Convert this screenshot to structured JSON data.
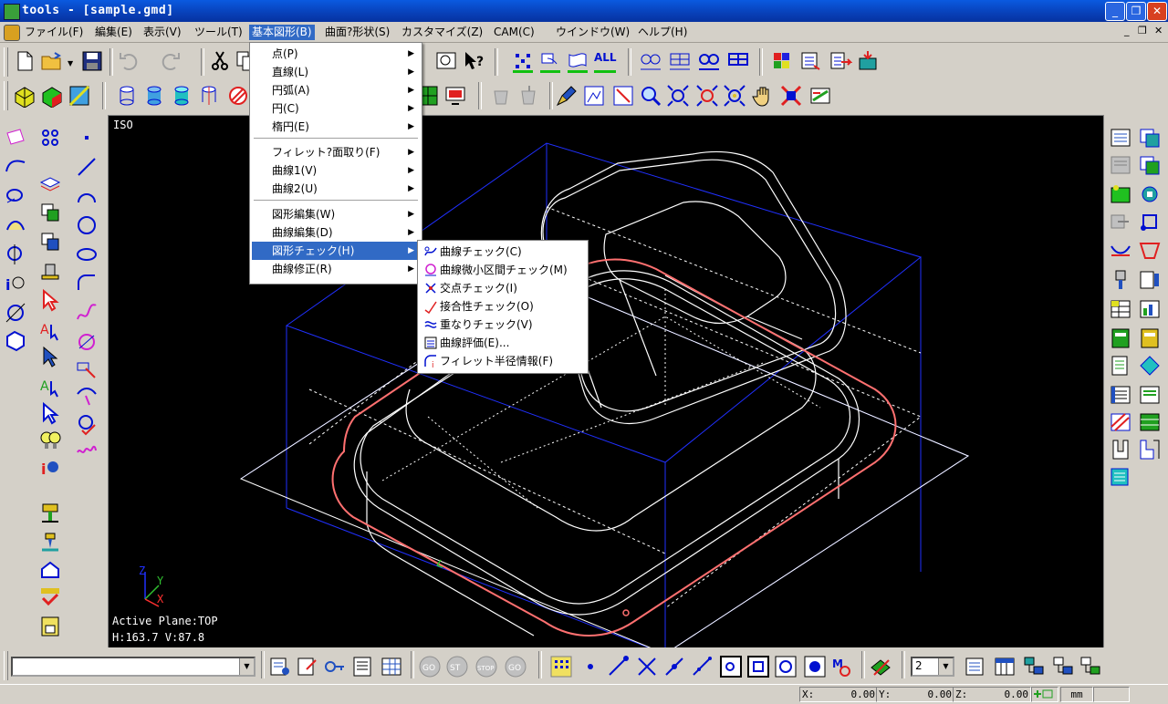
{
  "window": {
    "title": "tools - [sample.gmd]"
  },
  "menubar": {
    "items": [
      {
        "label": "ファイル(F)"
      },
      {
        "label": "編集(E)"
      },
      {
        "label": "表示(V)"
      },
      {
        "label": "ツール(T)"
      },
      {
        "label": "基本図形(B)"
      },
      {
        "label": "曲面?形状(S)"
      },
      {
        "label": "カスタマイズ(Z)"
      },
      {
        "label": "CAM(C)"
      },
      {
        "label": "ウインドウ(W)"
      },
      {
        "label": "ヘルプ(H)"
      }
    ]
  },
  "basic_menu": {
    "items": [
      {
        "label": "点(P)"
      },
      {
        "label": "直線(L)"
      },
      {
        "label": "円弧(A)"
      },
      {
        "label": "円(C)"
      },
      {
        "label": "楕円(E)"
      },
      {
        "label": "フィレット?面取り(F)"
      },
      {
        "label": "曲線1(V)"
      },
      {
        "label": "曲線2(U)"
      },
      {
        "label": "図形編集(W)"
      },
      {
        "label": "曲線編集(D)"
      },
      {
        "label": "図形チェック(H)"
      },
      {
        "label": "曲線修正(R)"
      }
    ]
  },
  "check_submenu": {
    "items": [
      {
        "label": "曲線チェック(C)"
      },
      {
        "label": "曲線微小区間チェック(M)"
      },
      {
        "label": "交点チェック(I)"
      },
      {
        "label": "接合性チェック(O)"
      },
      {
        "label": "重なりチェック(V)"
      },
      {
        "label": "曲線評価(E)..."
      },
      {
        "label": "フィレット半径情報(F)"
      }
    ]
  },
  "toolbar": {
    "all_label": "ALL"
  },
  "viewport": {
    "view_name": "ISO",
    "active_plane": "Active Plane:TOP",
    "hv": "H:163.7 V:87.8",
    "axes": {
      "z": "Z",
      "y": "Y",
      "x": "X"
    }
  },
  "bottom": {
    "layer_value": "2"
  },
  "status": {
    "x_label": "X:",
    "x_value": "0.00",
    "y_label": "Y:",
    "y_value": "0.00",
    "z_label": "Z:",
    "z_value": "0.00",
    "unit": "mm"
  },
  "colors": {
    "title_blue": "#0a4fd8",
    "menu_highlight": "#316ac5",
    "viewport_bg": "#000000",
    "curve_red": "#ff7070",
    "frame_blue": "#2030ff"
  }
}
